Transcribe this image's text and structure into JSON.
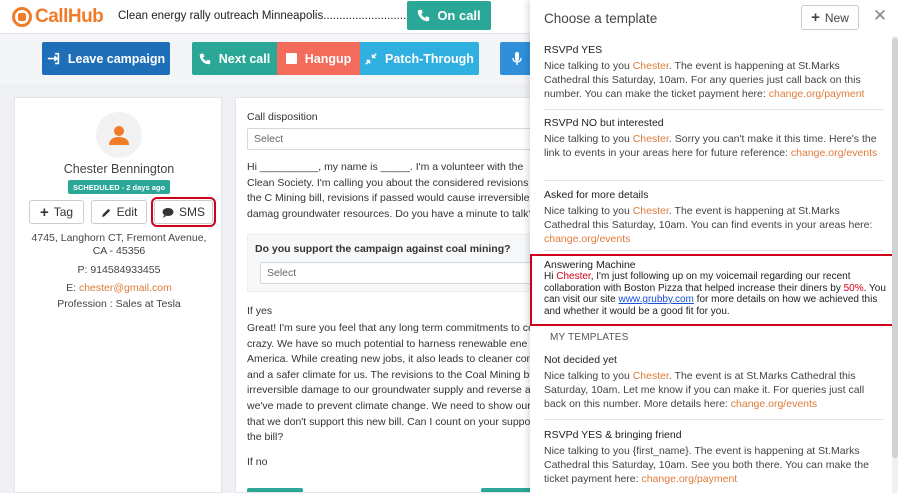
{
  "app": {
    "logo_text": "CallHub",
    "campaign_title": "Clean energy rally outreach Minneapolis.................................",
    "on_call_label": "On call"
  },
  "toolbar": {
    "leave_label": "Leave campaign",
    "next_label": "Next call",
    "hangup_label": "Hangup",
    "patch_label": "Patch-Through"
  },
  "contact": {
    "name": "Chester Bennington",
    "status_badge": "SCHEDULED - 2 days ago",
    "tag_label": "Tag",
    "edit_label": "Edit",
    "sms_label": "SMS",
    "address": "4745, Langhorn CT, Fremont Avenue, CA - 45356",
    "phone": "P: 914584933455",
    "email_prefix": "E: ",
    "email": "chester@gmail.com",
    "profession": "Profession : Sales at Tesla"
  },
  "script": {
    "disposition_label": "Call disposition",
    "disposition_placeholder": "Select",
    "intro": "Hi __________, my name is _____. I'm a volunteer with the Clean Society. I'm calling you about the considered revisions to the C Mining bill, revisions if passed would cause irreversible damag groundwater resources. Do you have a minute to talk?",
    "question": "Do you support the campaign against coal mining?",
    "question_placeholder": "Select",
    "if_yes_label": "If yes",
    "if_yes_text": "Great! I'm sure you feel that any long term commitments to co is crazy. We have so much potential to harness renewable ene America. While creating new jobs, it also leads to cleaner comr and a safer climate for us. The revisions to the Coal Mining bill irreversible damage to our groundwater supply and reverse ar we've made to prevent climate change. We need to show our p that we don't support this new bill. Can I count on your suppor the bill?",
    "if_no_label": "If no"
  },
  "templates_panel": {
    "title": "Choose a template",
    "new_label": "New",
    "close_label": "✕",
    "my_templates_label": "MY TEMPLATES",
    "templates": [
      {
        "title": "RSVPd YES",
        "pre": "Nice talking to you ",
        "name": "Chester",
        "post": ". The event is happening at St.Marks Cathedral this Saturday, 10am. For any queries just call back on this number. You can make the ticket payment here: ",
        "link": "change.org/payment"
      },
      {
        "title": "RSVPd NO but interested",
        "pre": "Nice talking to you ",
        "name": "Chester",
        "post": ". Sorry you can't make it this time. Here's the link to events in your areas here for future reference: ",
        "link": "change.org/events"
      },
      {
        "title": "Asked for more details",
        "pre": "Nice talking to you ",
        "name": "Chester",
        "post": ". The event is happening at St.Marks Cathedral this Saturday, 10am. You can find events in your areas here: ",
        "link": "change.org/events"
      },
      {
        "title": "Answering Machine",
        "pre": "Hi ",
        "name": "Chester",
        "mid": ", I'm just following up on my voicemail regarding our recent collaboration with Boston Pizza that helped increase their diners by ",
        "percent": "50%",
        "mid2": ". You can visit our site ",
        "link": "www.grubby.com",
        "post": " for more details on how we achieved this and whether it would be a good fit for you."
      },
      {
        "title": "Not decided yet",
        "pre": "Nice talking to you ",
        "name": "Chester",
        "post": ". The event is at St.Marks Cathedral this Saturday, 10am. Let me know if you can make it. For queries just call back on this number. More details here: ",
        "link": "change.org/events"
      },
      {
        "title": "RSVPd YES & bringing friend",
        "pre": "Nice talking to you {first_name}. The event is happening at St.Marks Cathedral this Saturday, 10am. See you both there. You can make the ticket payment here: ",
        "link": "change.org/payment"
      }
    ]
  },
  "colors": {
    "accent": "#2aa796",
    "brand": "#f07c2a",
    "highlight": "#d0021b",
    "link": "#e07b39"
  }
}
